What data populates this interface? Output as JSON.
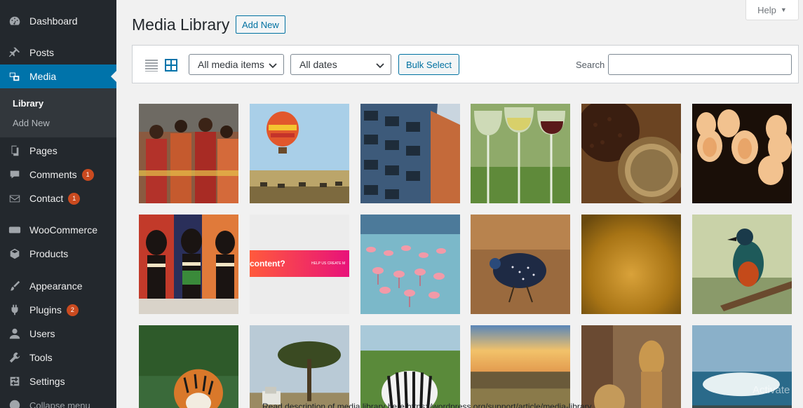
{
  "sidebar": {
    "dashboard": "Dashboard",
    "posts": "Posts",
    "media": "Media",
    "library": "Library",
    "add_new": "Add New",
    "pages": "Pages",
    "comments": "Comments",
    "comments_count": "1",
    "contact": "Contact",
    "contact_count": "1",
    "woocommerce": "WooCommerce",
    "products": "Products",
    "appearance": "Appearance",
    "plugins": "Plugins",
    "plugins_count": "2",
    "users": "Users",
    "tools": "Tools",
    "settings": "Settings",
    "collapse": "Collapse menu"
  },
  "header": {
    "title": "Media Library",
    "add_new": "Add New",
    "help": "Help"
  },
  "toolbar": {
    "filter_type": "All media items",
    "filter_date": "All dates",
    "bulk_select": "Bulk Select",
    "search_label": "Search",
    "search_value": ""
  },
  "grid": {
    "thumb_text_1": "content?",
    "thumb_text_2": "HELP US CREATE M"
  },
  "footer": {
    "partial_text": "Read description of media library here https://wordpress.org/support/article/media-library"
  },
  "watermark": "Activate",
  "colors": {
    "admin_sidebar": "#23282d",
    "active_menu": "#0073aa",
    "badge": "#ca4a1f"
  }
}
